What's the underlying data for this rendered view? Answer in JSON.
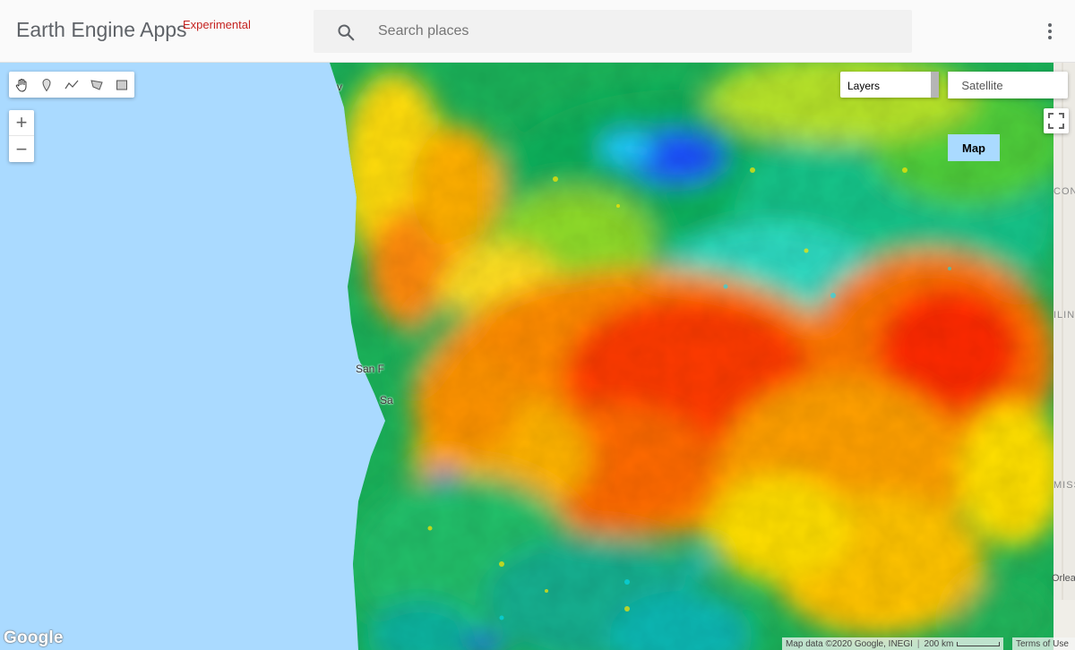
{
  "app": {
    "title": "Earth Engine Apps",
    "badge": "Experimental"
  },
  "search": {
    "placeholder": "Search places"
  },
  "map": {
    "zoom_in": "+",
    "zoom_out": "−",
    "layers_label": "Layers",
    "map_type": {
      "map_label": "Map",
      "satellite_label": "Satellite",
      "selected": "Map"
    },
    "tools": [
      "hand-icon",
      "marker-icon",
      "line-icon",
      "polygon-icon",
      "rectangle-icon"
    ],
    "places": {
      "san": "San F",
      "sa": "Sa",
      "v": "v"
    },
    "edge_labels": {
      "con": "CON",
      "ilino": "ILINO",
      "miss": "MISS",
      "orleans": "Orlean"
    },
    "logo_text": "Google",
    "attribution": "Map data ©2020 Google, INEGI",
    "scale": "200 km",
    "terms": "Terms of Use"
  },
  "colors": {
    "ocean": "#aadaff",
    "ramp": [
      "#0000ff",
      "#00ffff",
      "#00a050",
      "#ffff00",
      "#ff9900",
      "#ff0000"
    ]
  }
}
